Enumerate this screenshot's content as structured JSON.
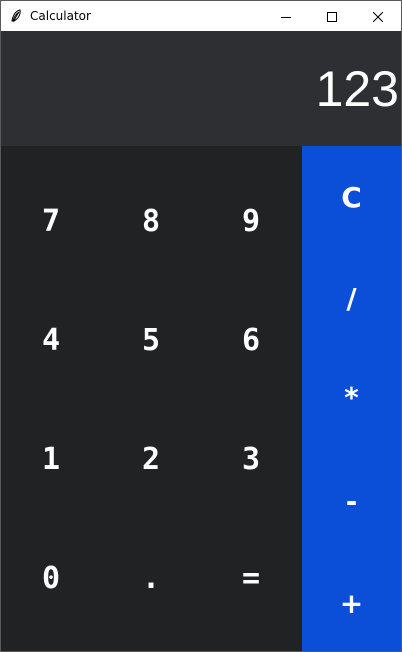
{
  "window": {
    "title": "Calculator",
    "icon": "feather-icon",
    "controls": [
      "minimize-icon",
      "maximize-icon",
      "close-icon"
    ]
  },
  "display": {
    "value": "123"
  },
  "keypad": {
    "rows": [
      [
        "7",
        "8",
        "9"
      ],
      [
        "4",
        "5",
        "6"
      ],
      [
        "1",
        "2",
        "3"
      ],
      [
        "0",
        ".",
        "="
      ]
    ]
  },
  "operators": [
    "C",
    "/",
    "*",
    "-",
    "+"
  ],
  "colors": {
    "display_bg": "#2e2f33",
    "keypad_bg": "#212224",
    "operator_bg": "#0b4fd9",
    "text": "#ffffff"
  }
}
